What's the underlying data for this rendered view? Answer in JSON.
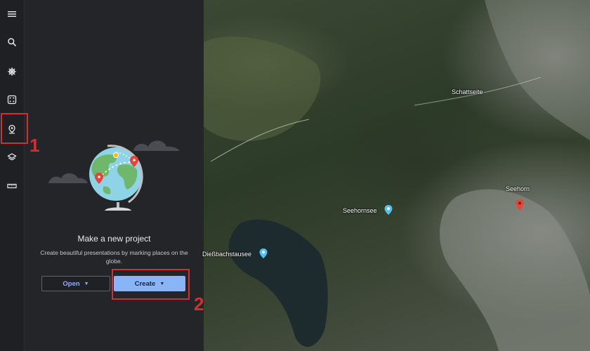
{
  "rail": {
    "items": [
      {
        "name": "menu",
        "icon": "hamburger-menu-icon"
      },
      {
        "name": "search",
        "icon": "search-icon"
      },
      {
        "name": "voyager",
        "icon": "ship-wheel-icon"
      },
      {
        "name": "feeling-lucky",
        "icon": "dice-icon"
      },
      {
        "name": "projects",
        "icon": "map-pin-icon",
        "highlighted": true
      },
      {
        "name": "map-style",
        "icon": "layers-icon"
      },
      {
        "name": "measure",
        "icon": "ruler-icon"
      }
    ]
  },
  "panel": {
    "title": "Make a new project",
    "description": "Create beautiful presentations by marking places on the globe.",
    "open_label": "Open",
    "create_label": "Create"
  },
  "map": {
    "labels": {
      "schattseite": "Schattseite",
      "seehorn": "Seehorn",
      "seehornsee": "Seehornsee",
      "diessbachstausee": "Dießbachstausee"
    }
  },
  "annotations": {
    "step1": "1",
    "step2": "2"
  },
  "colors": {
    "accent_blue": "#8ab4f8",
    "highlight_red": "#d32f2f",
    "pin_red": "#ea4335",
    "poi_blue": "#4fc3f7"
  }
}
